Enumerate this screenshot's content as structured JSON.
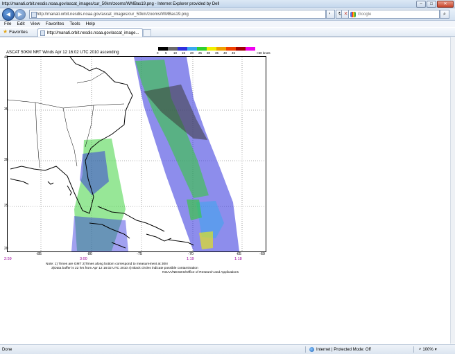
{
  "window": {
    "title": "http://manati.orbit.nesdis.noaa.gov/ascat_images/cur_50km/zooms/WMBas19.png - Internet Explorer provided by Dell"
  },
  "address_bar": {
    "url": "http://manati.orbit.nesdis.noaa.gov/ascat_images/cur_50km/zooms/WMBas19.png"
  },
  "search": {
    "placeholder": "Google"
  },
  "menu": [
    "File",
    "Edit",
    "View",
    "Favorites",
    "Tools",
    "Help"
  ],
  "favorites": {
    "label": "Favorites"
  },
  "tab": {
    "label": "http://manati.orbit.nesdis.noaa.gov/ascat_image..."
  },
  "plot": {
    "title": "ASCAT 50KM NRT Winds Apr 12 16:02 UTC 2010 ascending",
    "legend_labels": [
      "0",
      "5",
      "10",
      "15",
      "20",
      "25",
      "30",
      "35",
      "40",
      "45",
      ">50 knots"
    ],
    "legend_colors": [
      "#000000",
      "#6a6a6a",
      "#2f2fdd",
      "#3aa7ef",
      "#2fcf2f",
      "#f0f000",
      "#f0a000",
      "#f04000",
      "#a00000",
      "#f000f0",
      "#7a00c8"
    ],
    "y_labels": [
      "40",
      "35",
      "30",
      "25",
      "20"
    ],
    "x_labels": [
      "-85",
      "-80",
      "-75",
      "-70",
      "-65",
      "-60"
    ],
    "times": [
      "2:59",
      "3:00",
      "1:19",
      "1:18"
    ],
    "notes": "Note: 1) Times are GMT 2)Times along bottom correspond to measurement at 30N\n      3)Data buffer is 22 hrs from Apr 12 16:02 UTC 2010 4) Black circles indicate possible contamination",
    "credit": "NOAA/NESDIS/Office of Research and Applications"
  },
  "status": {
    "left": "Done",
    "zone": "Internet | Protected Mode: Off",
    "zoom": "100%"
  }
}
